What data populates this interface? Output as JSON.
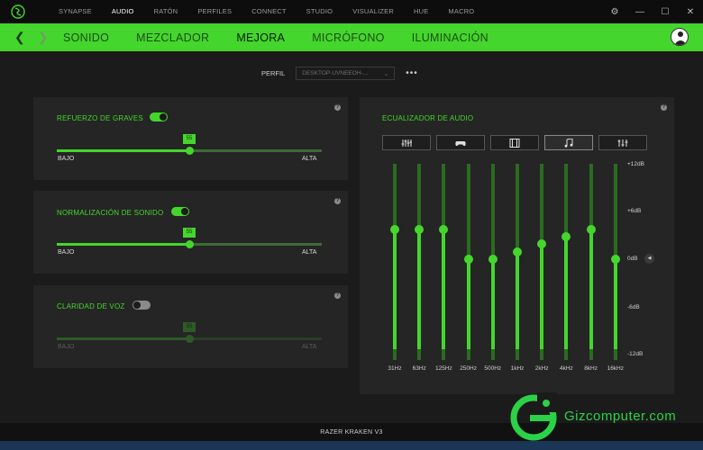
{
  "titlebar": {
    "nav": [
      "SYNAPSE",
      "AUDIO",
      "RATÓN",
      "PERFILES",
      "CONNECT",
      "STUDIO",
      "VISUALIZER",
      "HUE",
      "MACRO"
    ],
    "active_nav": "AUDIO",
    "controls": {
      "settings": "⚙",
      "minimize": "—",
      "maximize": "☐",
      "close": "✕"
    }
  },
  "subnav": {
    "back": "❮",
    "forward": "❯",
    "tabs": [
      "SONIDO",
      "MEZCLADOR",
      "MEJORA",
      "MICRÓFONO",
      "ILUMINACIÓN"
    ],
    "active_tab": "MEJORA"
  },
  "profile": {
    "label": "PERFIL",
    "selected": "DESKTOP-UVNEEOH-...",
    "more": "•••"
  },
  "cards": {
    "bass": {
      "title": "REFUERZO DE GRAVES",
      "enabled": true,
      "value": "55",
      "fraction": 0.5,
      "low": "BAJO",
      "high": "ALTA"
    },
    "norm": {
      "title": "NORMALIZACIÓN DE SONIDO",
      "enabled": true,
      "value": "55",
      "fraction": 0.5,
      "low": "BAJO",
      "high": "ALTA"
    },
    "voice": {
      "title": "CLARIDAD DE VOZ",
      "enabled": false,
      "value": "55",
      "fraction": 0.5,
      "low": "BAJO",
      "high": "ALTA"
    }
  },
  "eq": {
    "title": "ECUALIZADOR DE AUDIO",
    "presets": [
      "sliders-icon",
      "gamepad-icon",
      "film-icon",
      "music-icon",
      "custom-eq-icon"
    ],
    "active_preset": 3,
    "db_labels": [
      "+12dB",
      "+6dB",
      "0dB",
      "-6dB",
      "-12dB"
    ],
    "bands": [
      {
        "freq": "31Hz",
        "db": 4
      },
      {
        "freq": "63Hz",
        "db": 4
      },
      {
        "freq": "125Hz",
        "db": 4
      },
      {
        "freq": "250Hz",
        "db": 0
      },
      {
        "freq": "500Hz",
        "db": 0
      },
      {
        "freq": "1kHz",
        "db": 1
      },
      {
        "freq": "2kHz",
        "db": 2
      },
      {
        "freq": "4kHz",
        "db": 3
      },
      {
        "freq": "8kHz",
        "db": 4
      },
      {
        "freq": "16kHz",
        "db": 0
      }
    ],
    "reset": "◀"
  },
  "footer": {
    "device": "RAZER KRAKEN V3"
  },
  "watermark": {
    "text": "Gizcomputer.com"
  },
  "colors": {
    "accent": "#44d62c",
    "background": "#1b1b1b",
    "card": "#252525"
  }
}
